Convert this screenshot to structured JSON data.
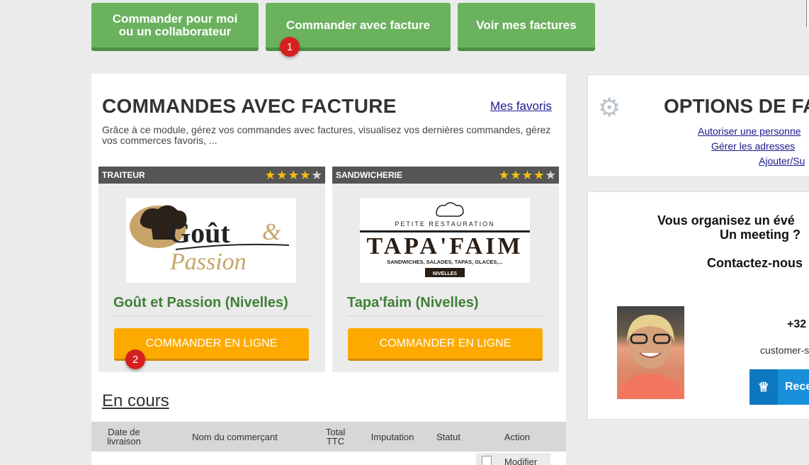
{
  "top_buttons": {
    "order_self": "Commander pour moi ou un collaborateur",
    "order_invoice": "Commander avec facture",
    "view_invoices": "Voir mes factures"
  },
  "markers": {
    "m1": "1",
    "m2": "2"
  },
  "main": {
    "title": "COMMANDES AVEC FACTURE",
    "favorites_link": "Mes favoris",
    "description": "Grâce à ce module, gérez vos commandes avec factures, visualisez vos dernières commandes, gérez vos commerces favoris, ..."
  },
  "cards": [
    {
      "category": "TRAITEUR",
      "rating": 4,
      "max_rating": 5,
      "name": "Goût et Passion (Nivelles)",
      "button": "COMMANDER EN LIGNE",
      "logo": {
        "word1": "Goût",
        "amp": "&",
        "word2": "Passion"
      }
    },
    {
      "category": "SANDWICHERIE",
      "rating": 4,
      "max_rating": 5,
      "name": "Tapa'faim (Nivelles)",
      "button": "COMMANDER EN LIGNE",
      "logo": {
        "top": "PETITE RESTAURATION",
        "main": "TAPA'FAIM",
        "sub": "SANDWICHES, SALADES, TAPAS, GLACES,...",
        "ribbon": "NIVELLES"
      }
    }
  ],
  "orders": {
    "title": "En cours",
    "columns": [
      "Date de livraison",
      "Nom du commerçant",
      "Total TTC",
      "Imputation",
      "Statut",
      "Action"
    ],
    "action_button": "Modifier"
  },
  "options": {
    "title": "OPTIONS DE FA",
    "links": [
      "Autoriser une personne",
      "Gérer les adresses",
      "Ajouter/Su"
    ]
  },
  "contact": {
    "line1": "Vous organisez un évé",
    "line2": "Un meeting ?",
    "line3": "Contactez-nous",
    "phone": "+32",
    "email": "customer-s",
    "button": "Rece"
  },
  "colors": {
    "green": "#6bb25f",
    "orange": "#fdaa00",
    "dark_green_text": "#3f8036",
    "link_blue": "#1a1a8c",
    "marker_red": "#d62020"
  },
  "icons": {
    "options": "gear-icon",
    "contact_button": "chef-hat-icon",
    "modify": "document-icon"
  }
}
